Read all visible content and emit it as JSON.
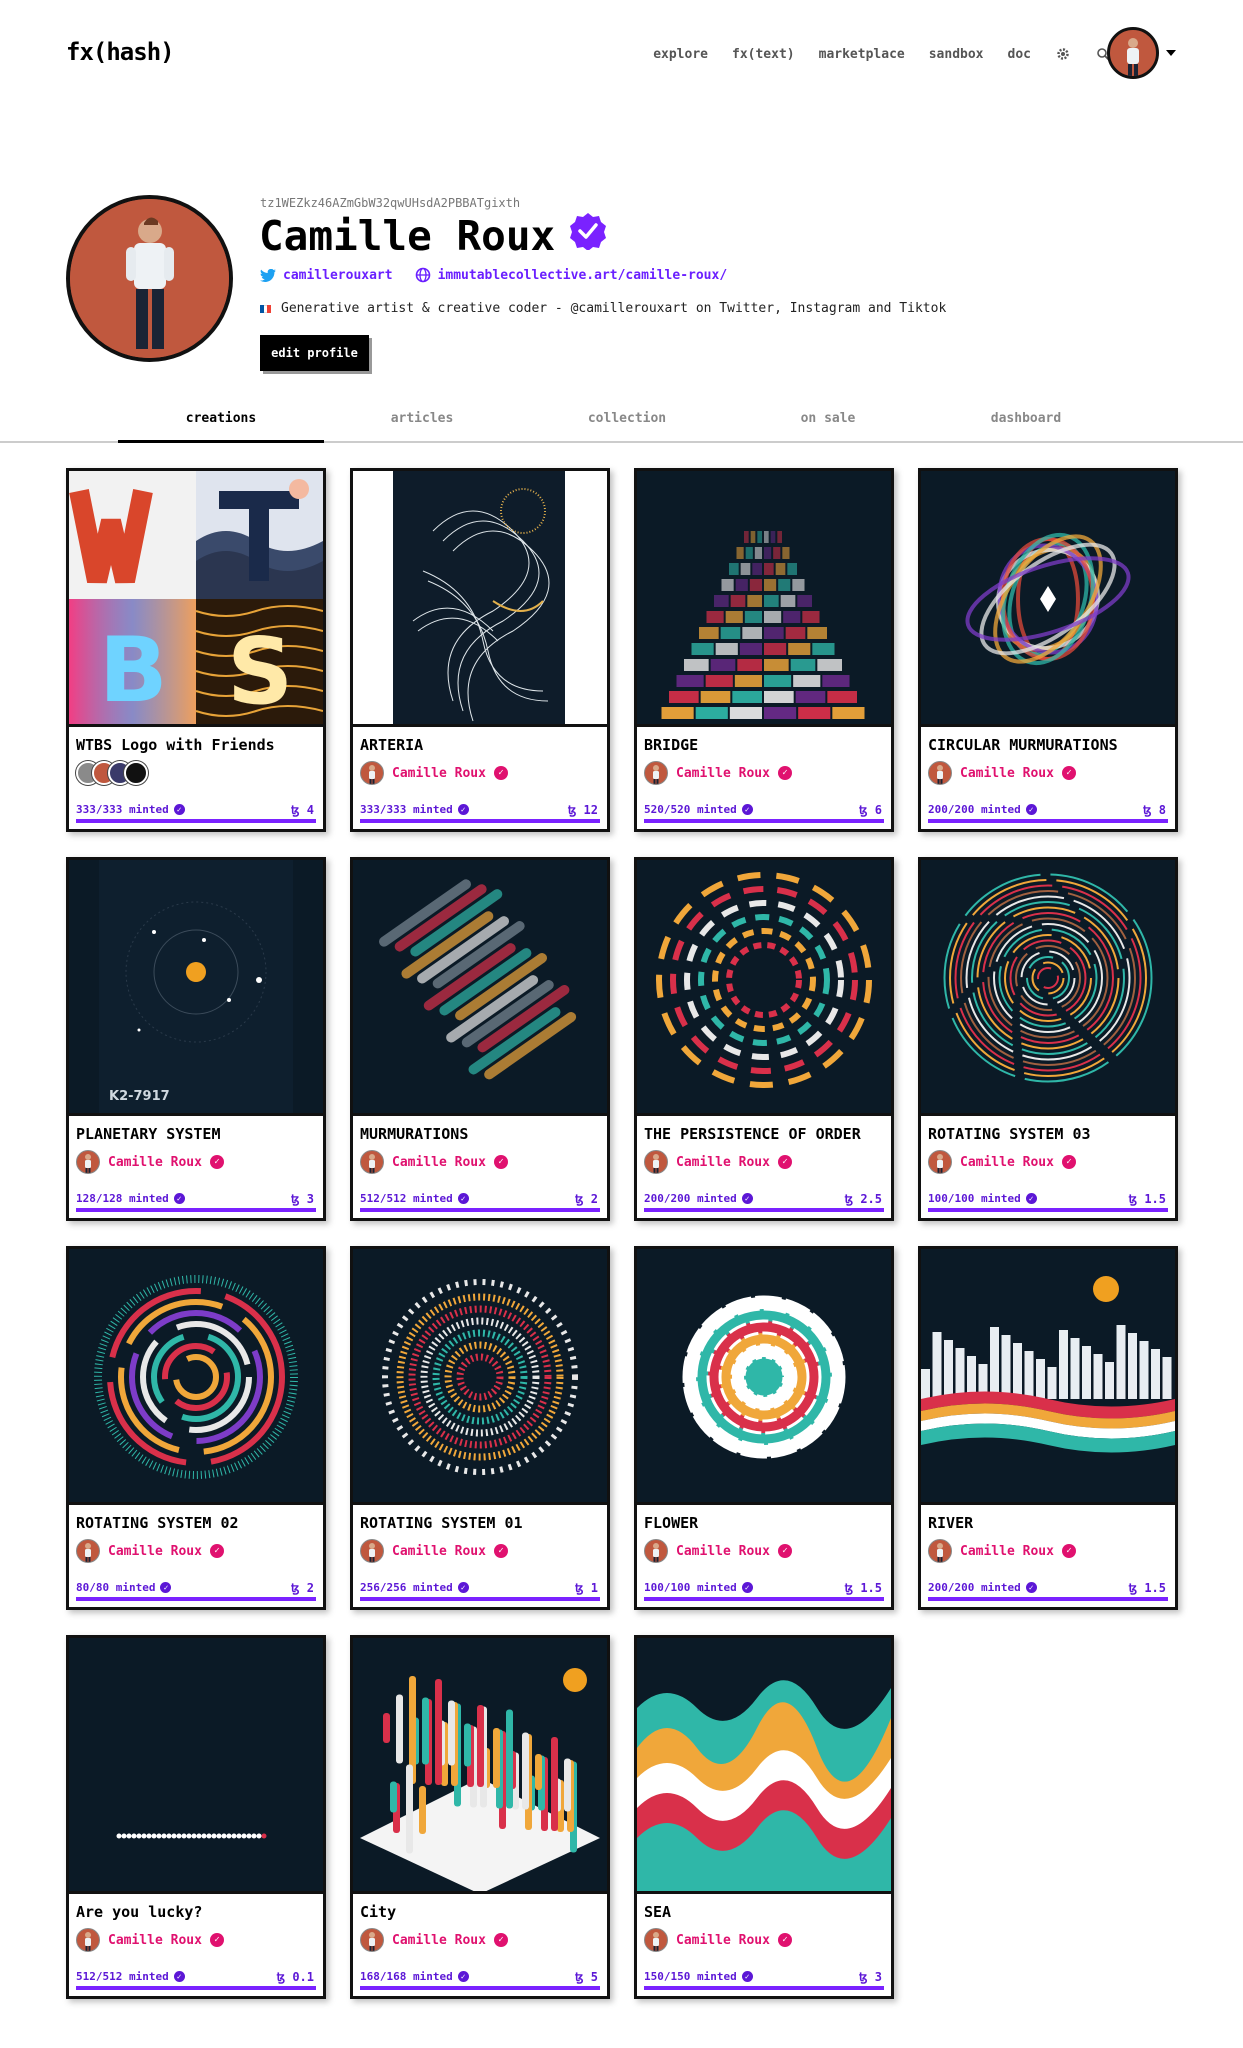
{
  "header": {
    "logo": "fx(hash)",
    "nav": [
      "explore",
      "fx(text)",
      "marketplace",
      "sandbox",
      "doc"
    ]
  },
  "profile": {
    "address": "tz1WEZkz46AZmGbW32qwUHsdA2PBBATgixth",
    "name": "Camille Roux",
    "twitter": "camillerouxart",
    "website": "immutablecollective.art/camille-roux/",
    "bio": "Generative artist & creative coder - @camillerouxart on Twitter, Instagram and Tiktok",
    "edit_label": "edit profile"
  },
  "tabs": [
    "creations",
    "articles",
    "collection",
    "on sale",
    "dashboard"
  ],
  "author": "Camille Roux",
  "cards": [
    {
      "title": "WTBS Logo with Friends",
      "minted": "333/333 minted",
      "price": "ꜩ 4"
    },
    {
      "title": "ARTERIA",
      "minted": "333/333 minted",
      "price": "ꜩ 12"
    },
    {
      "title": "BRIDGE",
      "minted": "520/520 minted",
      "price": "ꜩ 6"
    },
    {
      "title": "CIRCULAR MURMURATIONS",
      "minted": "200/200 minted",
      "price": "ꜩ 8"
    },
    {
      "title": "PLANETARY SYSTEM",
      "minted": "128/128 minted",
      "price": "ꜩ 3"
    },
    {
      "title": "MURMURATIONS",
      "minted": "512/512 minted",
      "price": "ꜩ 2"
    },
    {
      "title": "THE PERSISTENCE OF ORDER",
      "minted": "200/200 minted",
      "price": "ꜩ 2.5"
    },
    {
      "title": "ROTATING SYSTEM 03",
      "minted": "100/100 minted",
      "price": "ꜩ 1.5"
    },
    {
      "title": "ROTATING SYSTEM 02",
      "minted": "80/80 minted",
      "price": "ꜩ 2"
    },
    {
      "title": "ROTATING SYSTEM 01",
      "minted": "256/256 minted",
      "price": "ꜩ 1"
    },
    {
      "title": "FLOWER",
      "minted": "100/100 minted",
      "price": "ꜩ 1.5"
    },
    {
      "title": "RIVER",
      "minted": "200/200 minted",
      "price": "ꜩ 1.5"
    },
    {
      "title": "Are you lucky?",
      "minted": "512/512 minted",
      "price": "ꜩ 0.1"
    },
    {
      "title": "City",
      "minted": "168/168 minted",
      "price": "ꜩ 5"
    },
    {
      "title": "SEA",
      "minted": "150/150 minted",
      "price": "ꜩ 3"
    }
  ],
  "art": {
    "planet_label": "K2-7917"
  },
  "colors": {
    "accent": "#5c17d6",
    "author_pink": "#e0116f",
    "thumb_bg": "#0b1a26"
  }
}
